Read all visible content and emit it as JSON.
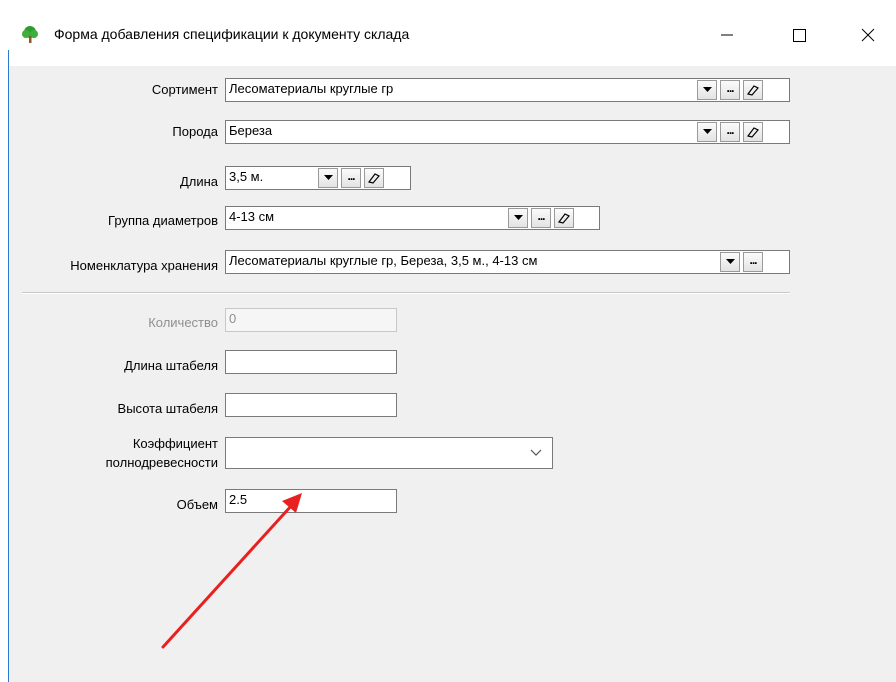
{
  "window": {
    "title": "Форма добавления спецификации к документу склада",
    "app_icon": "tree-icon"
  },
  "form": {
    "sortiment": {
      "label": "Сортимент",
      "value": "Лесоматериалы круглые гр"
    },
    "poroda": {
      "label": "Порода",
      "value": "Береза"
    },
    "dlina": {
      "label": "Длина",
      "value": "3,5 м."
    },
    "gruppa": {
      "label": "Группа диаметров",
      "value": "4-13 см"
    },
    "nomenklatura": {
      "label": "Номенклатура хранения",
      "value": "Лесоматериалы круглые гр, Береза, 3,5 м., 4-13 см"
    },
    "kolichestvo": {
      "label": "Количество",
      "value": "0"
    },
    "dlina_shtabelya": {
      "label": "Длина штабеля",
      "value": ""
    },
    "vysota_shtabelya": {
      "label": "Высота штабеля",
      "value": ""
    },
    "koeff": {
      "label_line1": "Коэффициент",
      "label_line2": "полнодревесности",
      "value": ""
    },
    "obem": {
      "label": "Объем",
      "value": "2.5"
    }
  },
  "annotation": {
    "arrow_color": "#e8201f"
  },
  "icons": {
    "dropdown": "dropdown-arrow-icon",
    "ellipsis": "ellipsis-icon",
    "clear": "eraser-icon",
    "minimize": "minimize-icon",
    "maximize": "maximize-icon",
    "close": "close-icon"
  }
}
